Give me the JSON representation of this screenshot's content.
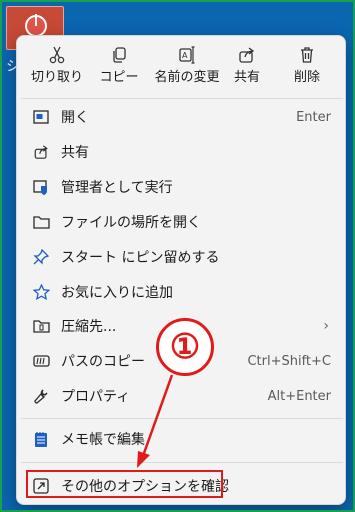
{
  "desktop": {
    "icon_label": "シ"
  },
  "quick_actions": [
    {
      "icon": "cut-icon",
      "label": "切り取り"
    },
    {
      "icon": "copy-icon",
      "label": "コピー"
    },
    {
      "icon": "rename-icon",
      "label": "名前の変更"
    },
    {
      "icon": "share-icon",
      "label": "共有"
    },
    {
      "icon": "delete-icon",
      "label": "削除"
    }
  ],
  "menu_items": [
    {
      "icon": "open-icon",
      "label": "開く",
      "accelerator": "Enter"
    },
    {
      "icon": "share-icon",
      "label": "共有",
      "accelerator": ""
    },
    {
      "icon": "shield-icon",
      "label": "管理者として実行",
      "accelerator": ""
    },
    {
      "icon": "folder-icon",
      "label": "ファイルの場所を開く",
      "accelerator": ""
    },
    {
      "icon": "pin-icon",
      "label": "スタート にピン留めする",
      "accelerator": ""
    },
    {
      "icon": "star-icon",
      "label": "お気に入りに追加",
      "accelerator": ""
    },
    {
      "icon": "compress-icon",
      "label": "圧縮先...",
      "accelerator": ""
    },
    {
      "icon": "path-copy-icon",
      "label": "パスのコピー",
      "accelerator": "Ctrl+Shift+C"
    },
    {
      "icon": "wrench-icon",
      "label": "プロパティ",
      "accelerator": "Alt+Enter"
    },
    {
      "icon": "notepad-icon",
      "label": "メモ帳で編集",
      "accelerator": ""
    },
    {
      "icon": "more-options-icon",
      "label": "その他のオプションを確認",
      "accelerator": ""
    }
  ],
  "annotation": {
    "marker": "①",
    "color": "#e01b1b"
  }
}
